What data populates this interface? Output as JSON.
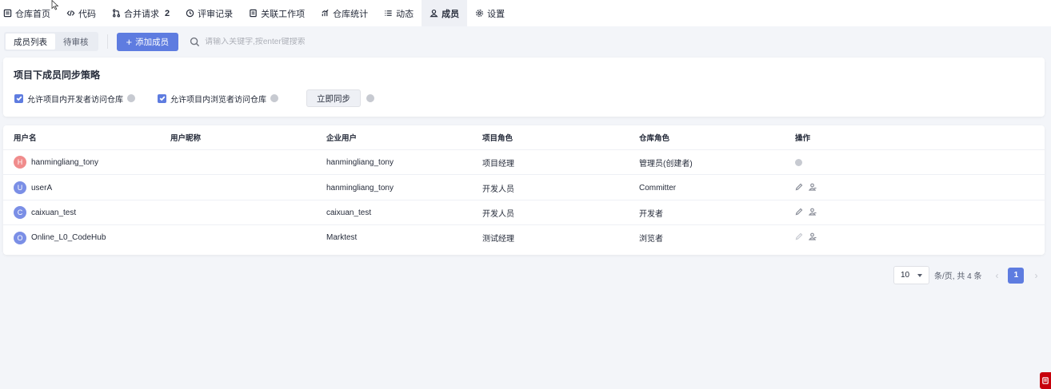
{
  "nav": {
    "tabs": [
      {
        "label": "仓库首页",
        "icon": "repo-home-icon"
      },
      {
        "label": "代码",
        "icon": "code-icon"
      },
      {
        "label": "合并请求",
        "icon": "merge-request-icon",
        "badge": "2"
      },
      {
        "label": "评审记录",
        "icon": "review-history-icon"
      },
      {
        "label": "关联工作项",
        "icon": "work-item-icon"
      },
      {
        "label": "仓库统计",
        "icon": "statistics-icon"
      },
      {
        "label": "动态",
        "icon": "activity-icon"
      },
      {
        "label": "成员",
        "icon": "member-icon",
        "active": true
      },
      {
        "label": "设置",
        "icon": "gear-icon"
      }
    ]
  },
  "toolbar": {
    "segments": [
      "成员列表",
      "待审核"
    ],
    "add_button": "添加成员",
    "search_placeholder": "请输入关键字,按enter键搜索"
  },
  "sync": {
    "title": "项目下成员同步策略",
    "options": [
      "允许项目内开发者访问仓库",
      "允许项目内浏览者访问仓库"
    ],
    "sync_button": "立即同步"
  },
  "table": {
    "headers": [
      "用户名",
      "用户昵称",
      "企业用户",
      "项目角色",
      "仓库角色",
      "操作"
    ],
    "rows": [
      {
        "initial": "H",
        "avatar_color": "#f08c8c",
        "username": "hanmingliang_tony",
        "nickname": "",
        "enterprise_user": "hanmingliang_tony",
        "project_role": "项目经理",
        "repo_role": "管理员(创建者)",
        "actions": "none"
      },
      {
        "initial": "U",
        "avatar_color": "#7b8fe6",
        "username": "userA",
        "nickname": "",
        "enterprise_user": "hanmingliang_tony",
        "project_role": "开发人员",
        "repo_role": "Committer",
        "actions": "enabled"
      },
      {
        "initial": "C",
        "avatar_color": "#7b8fe6",
        "username": "caixuan_test",
        "nickname": "",
        "enterprise_user": "caixuan_test",
        "project_role": "开发人员",
        "repo_role": "开发者",
        "actions": "enabled"
      },
      {
        "initial": "O",
        "avatar_color": "#7b8fe6",
        "username": "Online_L0_CodeHub",
        "nickname": "",
        "enterprise_user": "Marktest",
        "project_role": "测试经理",
        "repo_role": "浏览者",
        "actions": "disabled"
      }
    ]
  },
  "pagination": {
    "page_size": "10",
    "summary": "条/页, 共 4 条",
    "current_page": "1"
  },
  "colors": {
    "accent": "#5e7ce0",
    "float_button": "#c7000b"
  }
}
